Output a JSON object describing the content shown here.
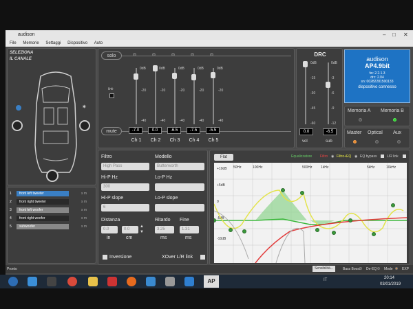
{
  "window": {
    "title": "audison",
    "menu": [
      "File",
      "Memorie",
      "Settaggi",
      "Dispositivo",
      "Auto"
    ]
  },
  "channel_select": {
    "title_line1": "SELEZIONA",
    "title_line2": "IL CANALE",
    "channels": [
      {
        "num": "1",
        "name": "front left tweeter",
        "color": "#3a7fc4"
      },
      {
        "num": "2",
        "name": "front right tweeter",
        "color": "#2a2a2a"
      },
      {
        "num": "3",
        "name": "front left woofer",
        "color": "#888888"
      },
      {
        "num": "4",
        "name": "front right woofer",
        "color": "#2a2a2a"
      },
      {
        "num": "5",
        "name": "subwoofer",
        "color": "#888888"
      }
    ]
  },
  "mixer": {
    "solo_label": "solo",
    "mute_label": "mute",
    "link_label": "link",
    "scale": [
      "0dB",
      "-20",
      "-40"
    ],
    "channels": [
      {
        "name": "Ch 1",
        "value": "-7.0",
        "level": 0.15
      },
      {
        "name": "Ch 2",
        "value": "0.0",
        "level": 0.0
      },
      {
        "name": "Ch 3",
        "value": "-6.5",
        "level": 0.14
      },
      {
        "name": "Ch 4",
        "value": "-7.5",
        "level": 0.16
      },
      {
        "name": "Ch 5",
        "value": "-5.5",
        "level": 0.12
      }
    ]
  },
  "drc": {
    "title": "DRC",
    "vol_label": "vol",
    "sub_label": "sub",
    "vol_value": "0.0",
    "sub_value": "-6.5",
    "vol_scale": [
      "0dB",
      "-15",
      "-30",
      "-45",
      "-60"
    ],
    "sub_scale": [
      "0dB",
      "-3",
      "-6",
      "-9",
      "-12"
    ]
  },
  "device": {
    "brand": "audison",
    "model": "AP4.9bit",
    "fw": "fw: 2.2.1.3",
    "drc": "drc: 2.04",
    "sn": "sn: 00282281500133",
    "status": "dispositivo connesso"
  },
  "memory": {
    "a": "Memoria A",
    "b": "Memoria B"
  },
  "source": {
    "master": "Master",
    "optical": "Optical",
    "aux": "Aux"
  },
  "filter": {
    "filtro_label": "Filtro",
    "filtro_value": "High Pass",
    "modello_label": "Modello",
    "modello_value": "Butterworth",
    "hip_hz_label": "Hi-P Hz",
    "hip_hz_value": "300",
    "lop_hz_label": "Lo-P Hz",
    "lop_hz_value": "",
    "hip_slope_label": "Hi-P slope",
    "hip_slope_value": "6",
    "lop_slope_label": "Lo-P slope",
    "lop_slope_value": "",
    "distanza_label": "Distanza",
    "dist_in": "0.0",
    "dist_cm": "0.0",
    "in_label": "in",
    "cm_label": "cm",
    "ritardo_label": "Ritardo",
    "ritardo_value": "3.25",
    "fine_label": "Fine",
    "fine_value": "1.31",
    "ms_label": "ms",
    "inversione_label": "Inversione",
    "xover_label": "XOver L/R link"
  },
  "eq": {
    "flat": "Flat",
    "equalizzatore": "Equalizzatore",
    "filtro": "Filtro",
    "filtro_eq": "Filtro+EQ",
    "eq_bypass": "EQ bypass",
    "lr_link": "L/R link",
    "x_labels": [
      "50Hz",
      "100Hz",
      "500Hz",
      "1kHz",
      "5kHz",
      "10kHz"
    ],
    "y_labels": [
      "+10dB",
      "+5dB",
      "0",
      "-5dB",
      "-10dB"
    ]
  },
  "status": {
    "left": "Pronto",
    "sensibilita": "Sensibilità...",
    "bass_boost": "Bass Boost",
    "de_eq": "De-EQ",
    "mode": "Mode",
    "mode_value": "EXP"
  },
  "taskbar": {
    "app_label": "AP",
    "time": "20:14",
    "date": "03/01/2019",
    "lang": "IT"
  }
}
